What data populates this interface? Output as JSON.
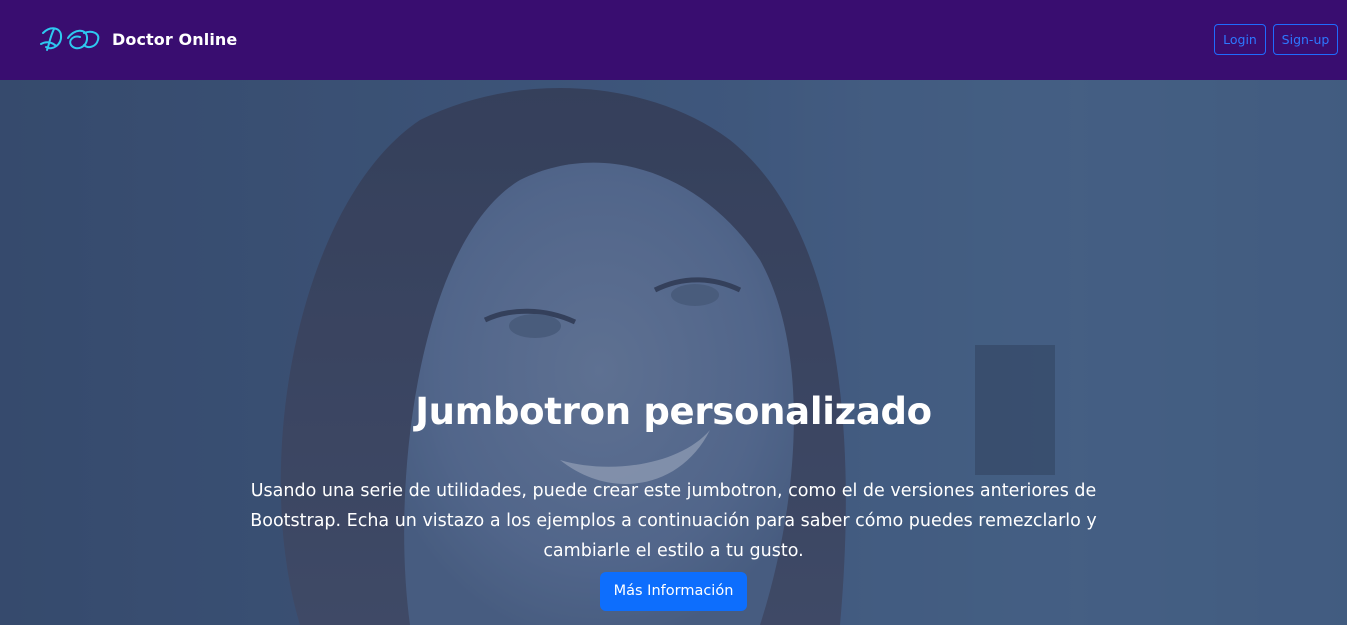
{
  "navbar": {
    "logo_icon": "DO-script-monogram-icon",
    "brand_name": "Doctor Online",
    "login_label": "Login",
    "signup_label": "Sign-up",
    "background_color": "#390d70",
    "button_color": "#1f6bfe"
  },
  "hero": {
    "background_image": "smiling-woman-photo",
    "title": "Jumbotron personalizado",
    "text": "Usando una serie de utilidades, puede crear este jumbotron, como el de versiones anteriores de Bootstrap. Echa un vistazo a los ejemplos a continuación para saber cómo puedes remezclarlo y cambiarle el estilo a tu gusto.",
    "cta_label": "Más Información",
    "cta_color": "#0d6efd"
  }
}
